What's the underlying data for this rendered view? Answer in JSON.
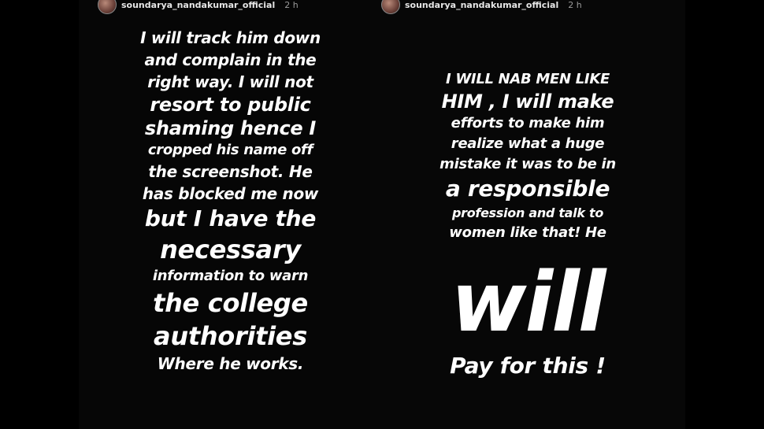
{
  "left_story": {
    "username": "soundarya_nandakumar_official",
    "time": "2 h",
    "lines": [
      "I will track him down",
      "and complain in the",
      "right way. I will not",
      "resort to public",
      "shaming hence I",
      "cropped his name off",
      "the screenshot. He",
      "has blocked me now",
      "but I have the",
      "necessary",
      "information to warn",
      "the college",
      "authorities",
      "Where he works."
    ]
  },
  "right_story": {
    "username": "soundarya_nandakumar_official",
    "time": "2 h",
    "lines": [
      "I WILL NAB MEN LIKE",
      "HIM , I will make",
      "efforts to make him",
      "realize what a huge",
      "mistake it was to be in",
      "a responsible",
      "profession and talk to",
      "women like that! He"
    ],
    "big_word": "will",
    "closing": "Pay for this !"
  }
}
